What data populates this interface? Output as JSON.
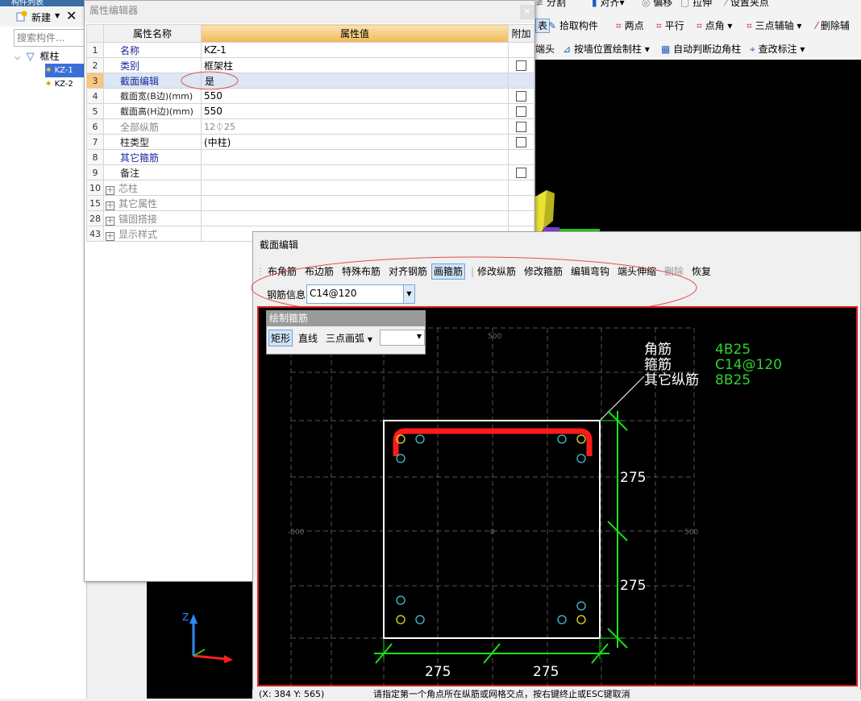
{
  "tree": {
    "title": "构件列表",
    "new_label": "新建",
    "search_placeholder": "搜索构件...",
    "root_label": "框柱",
    "items": [
      "KZ-1",
      "KZ-2"
    ]
  },
  "property_editor": {
    "title": "属性编辑器",
    "headers": {
      "name": "属性名称",
      "value": "属性值",
      "extra": "附加"
    },
    "rows": [
      {
        "num": "1",
        "name": "名称",
        "value": "KZ-1"
      },
      {
        "num": "2",
        "name": "类别",
        "value": "框架柱"
      },
      {
        "num": "3",
        "name": "截面编辑",
        "value": "是"
      },
      {
        "num": "4",
        "name": "截面宽(B边)(mm)",
        "value": "550"
      },
      {
        "num": "5",
        "name": "截面高(H边)(mm)",
        "value": "550"
      },
      {
        "num": "6",
        "name": "全部纵筋",
        "value": "12⏀25"
      },
      {
        "num": "7",
        "name": "柱类型",
        "value": "(中柱)"
      },
      {
        "num": "8",
        "name": "其它箍筋",
        "value": ""
      },
      {
        "num": "9",
        "name": "备注",
        "value": ""
      },
      {
        "num": "10",
        "name": "芯柱",
        "value": ""
      },
      {
        "num": "15",
        "name": "其它属性",
        "value": ""
      },
      {
        "num": "28",
        "name": "锚固搭接",
        "value": ""
      },
      {
        "num": "43",
        "name": "显示样式",
        "value": ""
      }
    ]
  },
  "main_toolbar": {
    "row0": [
      "分割",
      "对齐",
      "偏移",
      "拉伸",
      "设置夹点"
    ],
    "row1": [
      "表",
      "拾取构件",
      "两点",
      "平行",
      "点角",
      "三点辅轴",
      "删除辅"
    ],
    "row2": [
      "端头",
      "按墙位置绘制柱",
      "自动判断边角柱",
      "查改标注"
    ]
  },
  "section_editor": {
    "title": "截面编辑",
    "tools": [
      "布角筋",
      "布边筋",
      "特殊布筋",
      "对齐钢筋",
      "画箍筋",
      "修改纵筋",
      "修改箍筋",
      "编辑弯钩",
      "端头伸缩",
      "删除",
      "恢复"
    ],
    "active_tool": "画箍筋",
    "rebar_info_label": "钢筋信息",
    "rebar_info_value": "C14@120",
    "draw_panel": {
      "title": "绘制箍筋",
      "options": [
        "矩形",
        "直线",
        "三点画弧"
      ],
      "active": "矩形"
    },
    "legend": [
      {
        "label": "角筋",
        "value": "4B25"
      },
      {
        "label": "箍筋",
        "value": "C14@120"
      },
      {
        "label": "其它纵筋",
        "value": "8B25"
      }
    ],
    "grid_labels": {
      "top": "500",
      "left": "-500",
      "center": "0",
      "right": "500"
    },
    "dimensions": {
      "right_upper": "275",
      "right_lower": "275",
      "bottom_left": "275",
      "bottom_right": "275"
    }
  },
  "status_bar": {
    "coords": "(X: 384 Y: 565)",
    "message": "请指定第一个角点所在纵筋或网格交点，按右键终止或ESC键取消"
  },
  "colors": {
    "legend_value": "#2fd32f",
    "dimension": "#19e019",
    "stirrup": "#ff1a1a",
    "corner_bar": "#e8e620",
    "side_bar": "#3ec7d6",
    "canvas_border": "#e02020"
  }
}
